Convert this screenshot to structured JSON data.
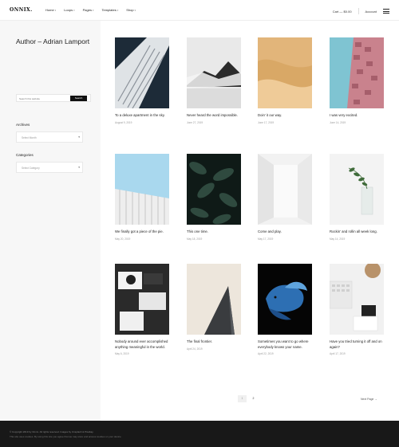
{
  "header": {
    "logo": "ONNIX.",
    "nav": [
      {
        "label": "Home",
        "has_dropdown": true
      },
      {
        "label": "Loops",
        "has_dropdown": true
      },
      {
        "label": "Pages",
        "has_dropdown": true
      },
      {
        "label": "Templates",
        "has_dropdown": true
      },
      {
        "label": "Shop",
        "has_dropdown": true
      }
    ],
    "cart": "Cart — $0.00",
    "account": "Account",
    "menu_icon": "hamburger-icon"
  },
  "sidebar": {
    "author_title": "Author – Adrian Lamport",
    "search": {
      "placeholder": "Search this website",
      "button": "Search"
    },
    "archives": {
      "title": "Archives",
      "selected": "Select Month"
    },
    "categories": {
      "title": "Categories",
      "selected": "Select Category"
    }
  },
  "posts": [
    {
      "title": "To a deluxe apartment in the sky.",
      "date": "August 9, 2019"
    },
    {
      "title": "Never heard the word impossible.",
      "date": "June 27, 2019"
    },
    {
      "title": "Doin' it our way.",
      "date": "June 17, 2019"
    },
    {
      "title": "I was very excited.",
      "date": "June 14, 2019"
    },
    {
      "title": "We finally got a piece of the pie.",
      "date": "May 20, 2019"
    },
    {
      "title": "This one time.",
      "date": "May 18, 2019"
    },
    {
      "title": "Come and play.",
      "date": "May 17, 2019"
    },
    {
      "title": "Rockin' and rollin all week long.",
      "date": "May 14, 2019"
    },
    {
      "title": "Nobody around ever accomplished anything meaningful in the world.",
      "date": "May 6, 2019"
    },
    {
      "title": "The final frontier.",
      "date": "April 24, 2019"
    },
    {
      "title": "Sometimes you want to go where everybody knows your name.",
      "date": "April 22, 2019"
    },
    {
      "title": "Have you tried turning it off and on again?",
      "date": "April 17, 2019"
    }
  ],
  "pagination": {
    "pages": [
      "1",
      "2"
    ],
    "current": "1",
    "next": "Next Page →"
  },
  "footer": {
    "line1": "© Copyright 2019 by Onnix. All rights reserved. Images by Unsplash & Pixabay.",
    "line2": "This site uses cookies. By using this site you agree that we may store and access cookies on your device."
  },
  "colors": {
    "sidebar_bg": "#f7f7f7",
    "footer_bg": "#181818",
    "accent": "#111111"
  }
}
